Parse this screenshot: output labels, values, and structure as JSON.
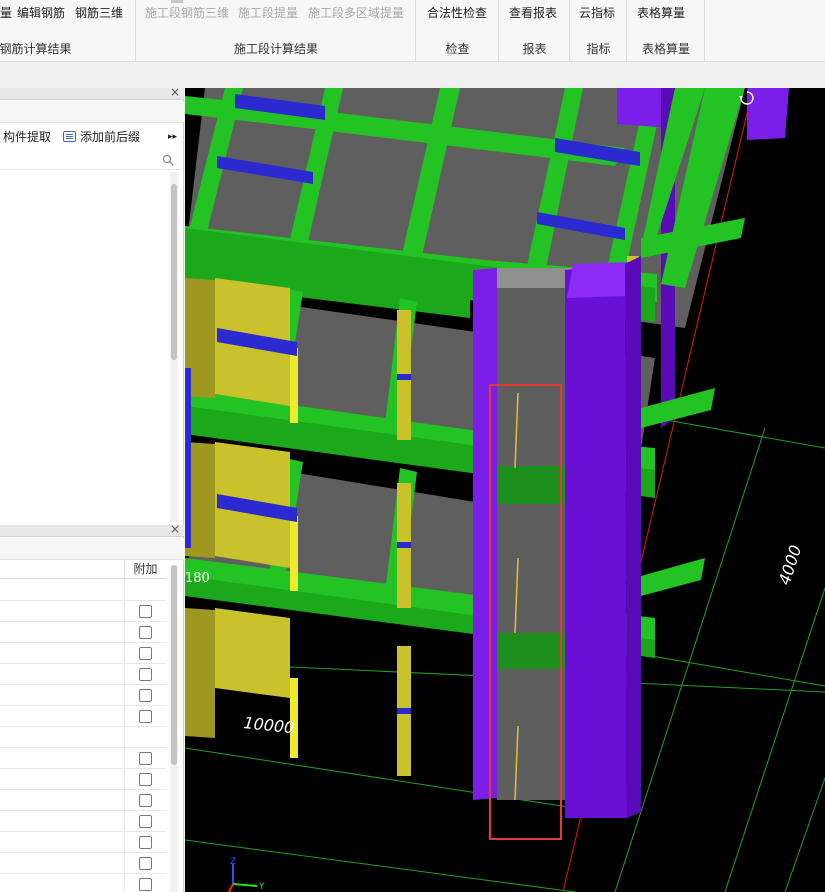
{
  "ribbon": {
    "group1": {
      "buttons": [
        "量",
        "编辑钢筋",
        "钢筋三维"
      ],
      "label": "钢筋计算结果"
    },
    "group2": {
      "buttons": [
        "施工段钢筋三维",
        "施工段提量",
        "施工段多区域提量"
      ],
      "label": "施工段计算结果"
    },
    "group3": {
      "buttons": [
        "合法性检查"
      ],
      "label": "检查"
    },
    "group4": {
      "buttons": [
        "查看报表"
      ],
      "label": "报表"
    },
    "group5": {
      "buttons": [
        "云指标"
      ],
      "label": "指标"
    },
    "group6": {
      "buttons": [
        "表格算量"
      ],
      "label": "表格算量"
    }
  },
  "left_panel": {
    "top_pane": {
      "close_icon": "close-icon",
      "tools": [
        "构件提取",
        "添加前后缀"
      ],
      "more_icon": "double-chevron-right-icon",
      "search_icon": "search-icon",
      "search_value": ""
    },
    "bottom_pane": {
      "close_icon": "close-icon",
      "column_attach": "附加",
      "rows": [
        {
          "checkbox": false
        },
        {
          "checkbox": true
        },
        {
          "checkbox": true
        },
        {
          "checkbox": true
        },
        {
          "checkbox": true
        },
        {
          "checkbox": true
        },
        {
          "checkbox": true
        },
        {
          "checkbox": false
        },
        {
          "checkbox": true
        },
        {
          "checkbox": true
        },
        {
          "checkbox": true
        },
        {
          "checkbox": true
        },
        {
          "checkbox": true
        },
        {
          "checkbox": true
        },
        {
          "checkbox": true
        }
      ]
    }
  },
  "viewport": {
    "dimension_labels": {
      "front": "10000",
      "side": "4000",
      "left_edge": "180"
    },
    "corner_icon": "rotate-icon",
    "axis_labels": {
      "z": "Z",
      "x": "X",
      "y": "Y"
    },
    "colors": {
      "background": "#000000",
      "beam_green": "#22c322",
      "column_purple": "#7b1fe8",
      "wall_yellow": "#c9c22a",
      "slab_gray": "#5f5f5f",
      "rebar_blue": "#2a2ad0",
      "highlight_red": "#e53935",
      "grid_green": "#1fa21f"
    }
  }
}
